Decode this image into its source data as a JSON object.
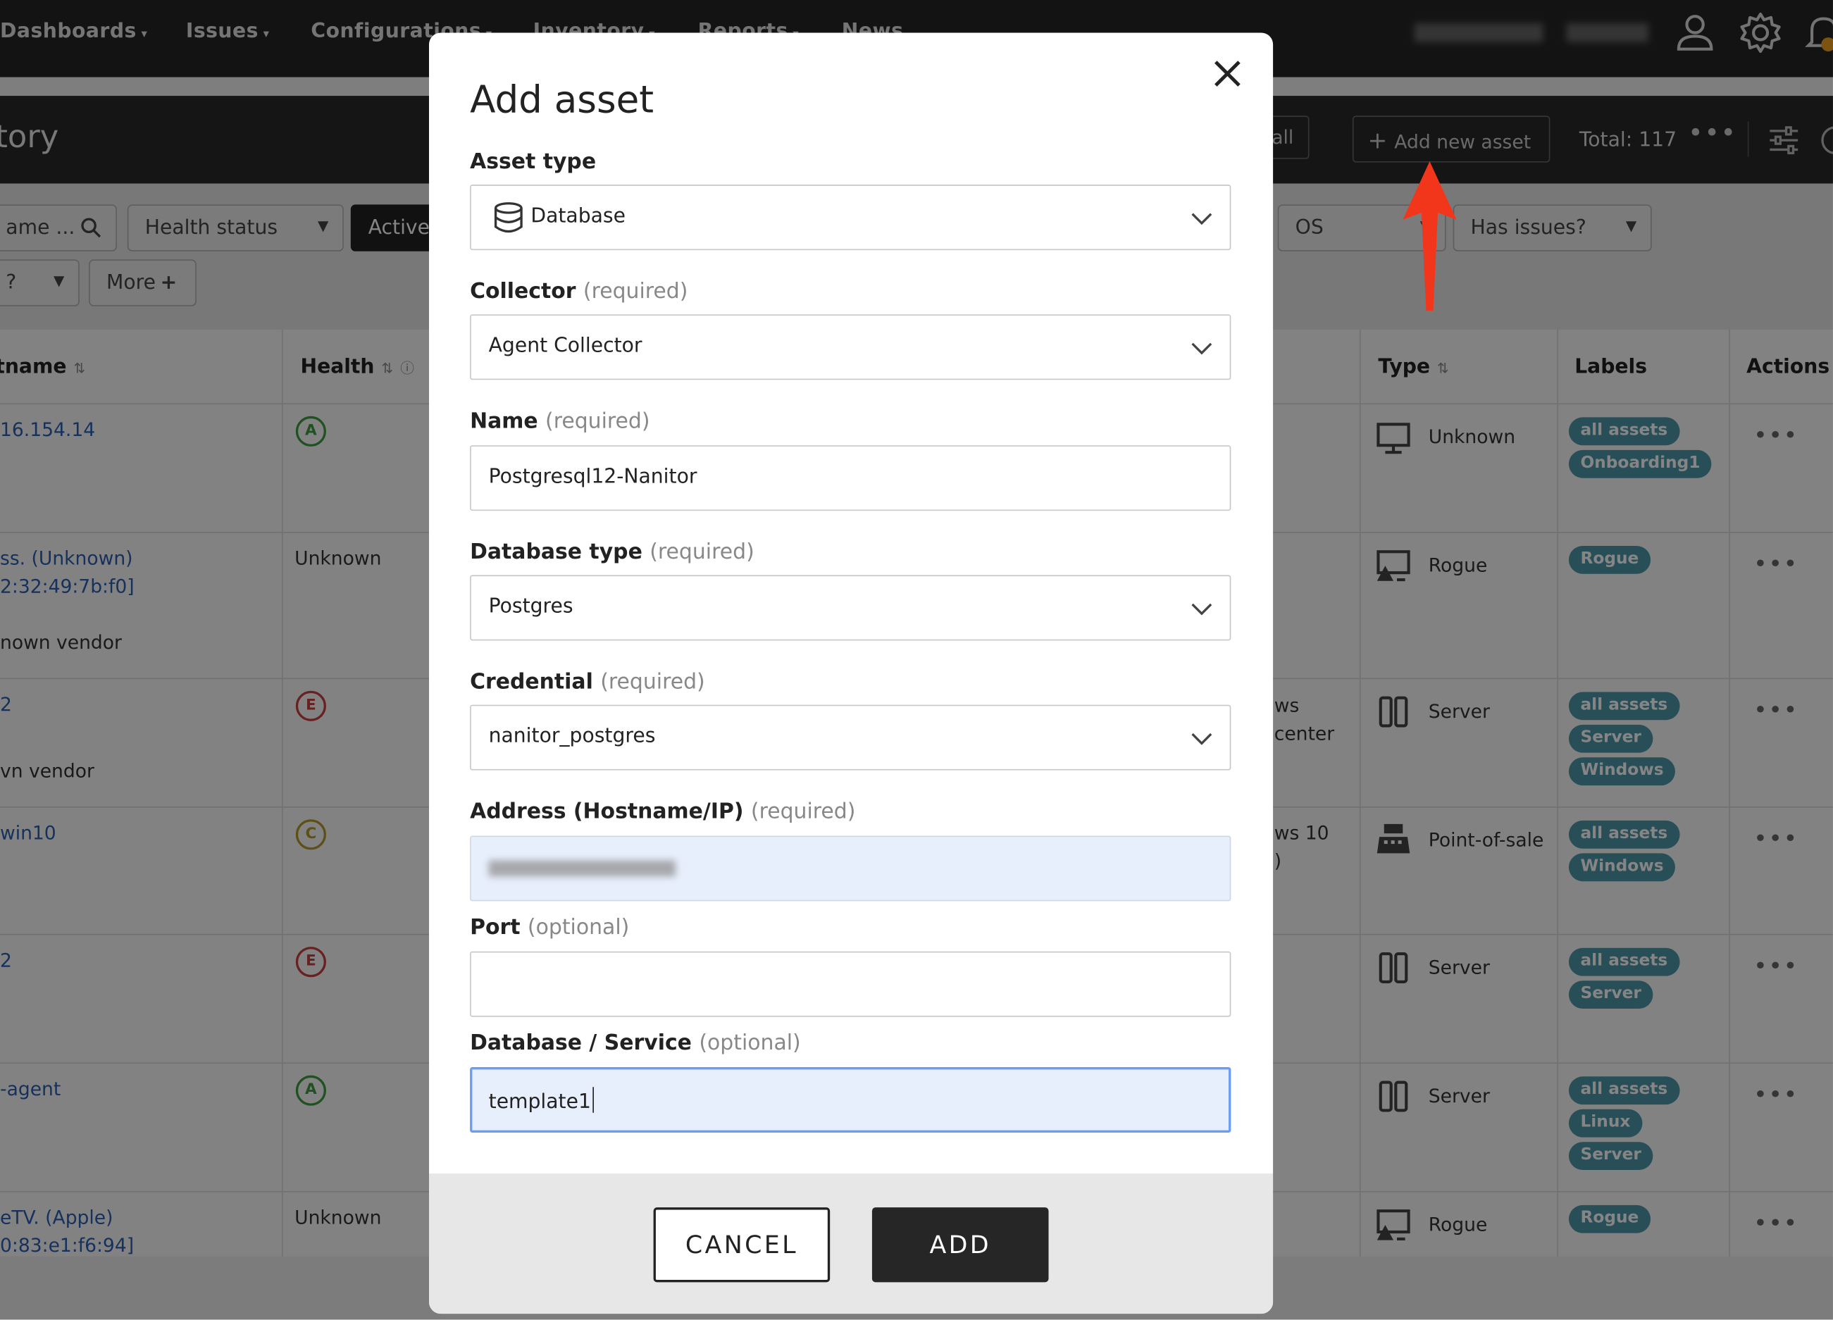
{
  "nav": {
    "items": [
      "Dashboards",
      "Issues",
      "Configurations",
      "Inventory",
      "Reports",
      "News"
    ]
  },
  "page": {
    "title": "tory",
    "assign_all": "o all",
    "add_new_asset": "Add new asset",
    "total": "Total: 117"
  },
  "filters": {
    "name": "ame ...",
    "health_status": "Health status",
    "active": "Active",
    "os": "OS",
    "has_issues": "Has issues?",
    "second_row_first": "?",
    "more": "More"
  },
  "table": {
    "headers": {
      "hostname": "tname",
      "health": "Health",
      "type": "Type",
      "labels": "Labels",
      "actions": "Actions"
    },
    "rows": [
      {
        "host1": "16.154.14",
        "host2": "",
        "host3": "",
        "grade": "A",
        "health_text": "",
        "os1": "",
        "os2": "",
        "type": "Unknown",
        "labels": [
          "all assets",
          "Onboarding1"
        ]
      },
      {
        "host1": "ss. (Unknown)",
        "host2": "2:32:49:7b:f0]",
        "host3": "nown vendor",
        "grade": "",
        "health_text": "Unknown",
        "os1": "",
        "os2": "",
        "type": "Rogue",
        "labels": [
          "Rogue"
        ]
      },
      {
        "host1": "2",
        "host2": "",
        "host3": "vn vendor",
        "grade": "E",
        "health_text": "",
        "os1": "ws",
        "os2": "center",
        "type": "Server",
        "labels": [
          "all assets",
          "Server",
          "Windows"
        ]
      },
      {
        "host1": "win10",
        "host2": "",
        "host3": "",
        "grade": "C",
        "health_text": "",
        "os1": "ws 10",
        "os2": ")",
        "type": "Point-of-sale",
        "labels": [
          "all assets",
          "Windows"
        ]
      },
      {
        "host1": "2",
        "host2": "",
        "host3": "",
        "grade": "E",
        "health_text": "",
        "os1": "",
        "os2": "",
        "type": "Server",
        "labels": [
          "all assets",
          "Server"
        ]
      },
      {
        "host1": "-agent",
        "host2": "",
        "host3": "",
        "grade": "A",
        "health_text": "",
        "os1": "",
        "os2": "",
        "type": "Server",
        "labels": [
          "all assets",
          "Linux",
          "Server"
        ]
      },
      {
        "host1": "eTV. (Apple)",
        "host2": "0:83:e1:f6:94]",
        "host3": "",
        "grade": "",
        "health_text": "Unknown",
        "os1": "",
        "os2": "",
        "type": "Rogue",
        "labels": [
          "Rogue"
        ]
      }
    ]
  },
  "modal": {
    "title": "Add asset",
    "required_hint": "(required)",
    "optional_hint": "(optional)",
    "asset_type": {
      "label": "Asset type",
      "value": "Database"
    },
    "collector": {
      "label": "Collector",
      "value": "Agent Collector"
    },
    "name": {
      "label": "Name",
      "value": "Postgresql12-Nanitor"
    },
    "database_type": {
      "label": "Database type",
      "value": "Postgres"
    },
    "credential": {
      "label": "Credential",
      "value": "nanitor_postgres"
    },
    "address": {
      "label": "Address (Hostname/IP)",
      "value": ""
    },
    "port": {
      "label": "Port",
      "value": ""
    },
    "database_service": {
      "label": "Database / Service",
      "value": "template1"
    },
    "cancel": "CANCEL",
    "add": "ADD"
  },
  "colors": {
    "label_bg": "#4e96a9",
    "annotation_arrow": "#f2361c",
    "focus_border": "#6a9ef0",
    "field_fill": "#e8effc"
  }
}
